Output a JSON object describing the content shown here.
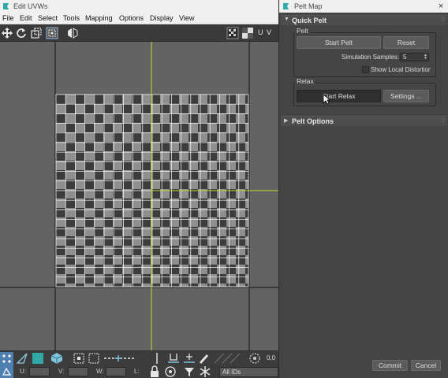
{
  "uvw_window": {
    "title": "Edit UVWs",
    "menu": [
      "File",
      "Edit",
      "Select",
      "Tools",
      "Mapping",
      "Options",
      "Display",
      "View"
    ],
    "toolbar_right_label": "U V",
    "bottom": {
      "readout": "0,0",
      "u_label": "U:",
      "v_label": "V:",
      "w_label": "W:",
      "l_label": "L:",
      "ids_select": "All IDs"
    }
  },
  "pelt_window": {
    "title": "Pelt Map",
    "close_glyph": "×",
    "quick_pelt": {
      "header": "Quick Pelt",
      "pelt_group": {
        "label": "Pelt",
        "start_pelt": "Start Pelt",
        "reset": "Reset",
        "sim_samples_label": "Simulation Samples:",
        "sim_samples_value": "5",
        "show_distortions_label": "Show Local Distortions"
      },
      "relax_group": {
        "label": "Relax",
        "start_relax": "Start Relax",
        "settings": "Settings ..."
      }
    },
    "pelt_options": {
      "header": "Pelt Options"
    },
    "commit": "Commit",
    "cancel": "Cancel"
  },
  "colors": {
    "panel_bg": "#444444",
    "viewport_bg": "#636363",
    "axis_line": "#c6d63a",
    "uv_wire": "#ffffff",
    "checker_light": "#8f8f8f",
    "checker_dark": "#3c3c3c",
    "accent_icon": "#2fa7a7"
  }
}
